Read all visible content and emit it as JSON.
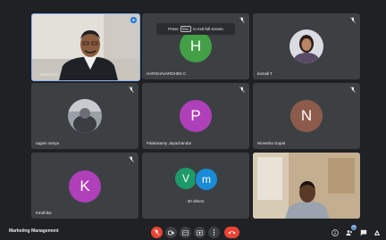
{
  "toast": {
    "press": "Press",
    "key": "Esc",
    "rest": "to exit full screen"
  },
  "tiles": [
    {
      "name": "...lakrishnan"
    },
    {
      "name": "HARSHAVARDHINI C",
      "initial": "H",
      "color": "#43a047"
    },
    {
      "name": "kamali T"
    },
    {
      "name": "ragavi ramya"
    },
    {
      "name": "Palanisamy Jayachandar",
      "initial": "P",
      "color": "#b03fba"
    },
    {
      "name": "Niveetha Gopal",
      "initial": "N",
      "color": "#8d5b4c"
    },
    {
      "name": "Kiruthika",
      "initial": "K",
      "color": "#b03fba"
    },
    {
      "others_label": "30 others",
      "initial1": "V",
      "color1": "#1e9a6a",
      "initial2": "m",
      "color2": "#1a8bd6"
    },
    {
      "name": ""
    }
  ],
  "bottom_bar": {
    "meeting_title": "Marketing Management",
    "participant_count": "41",
    "end_call_color": "#ea4335"
  },
  "icons": [
    "mic-off-icon",
    "camera-icon",
    "captions-icon",
    "present-icon",
    "more-icon",
    "end-call-icon",
    "info-icon",
    "people-icon",
    "chat-icon",
    "activities-icon"
  ]
}
